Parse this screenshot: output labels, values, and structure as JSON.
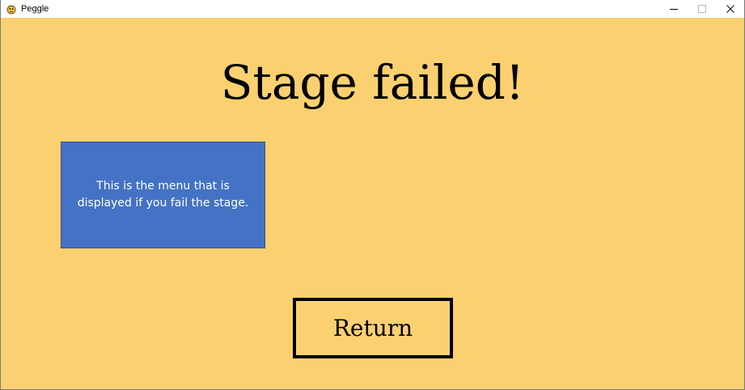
{
  "window": {
    "title": "Peggle",
    "controls": {
      "minimize_icon": "minimize-icon",
      "maximize_icon": "maximize-icon",
      "close_icon": "close-icon"
    }
  },
  "screen": {
    "title": "Stage failed!",
    "info_box": {
      "text": "This is the menu that is displayed if you fail the stage."
    },
    "return_button": {
      "label": "Return"
    }
  },
  "colors": {
    "background": "#fad071",
    "info_box": "#4472c4",
    "text": "#000000",
    "info_text": "#ffffff"
  }
}
